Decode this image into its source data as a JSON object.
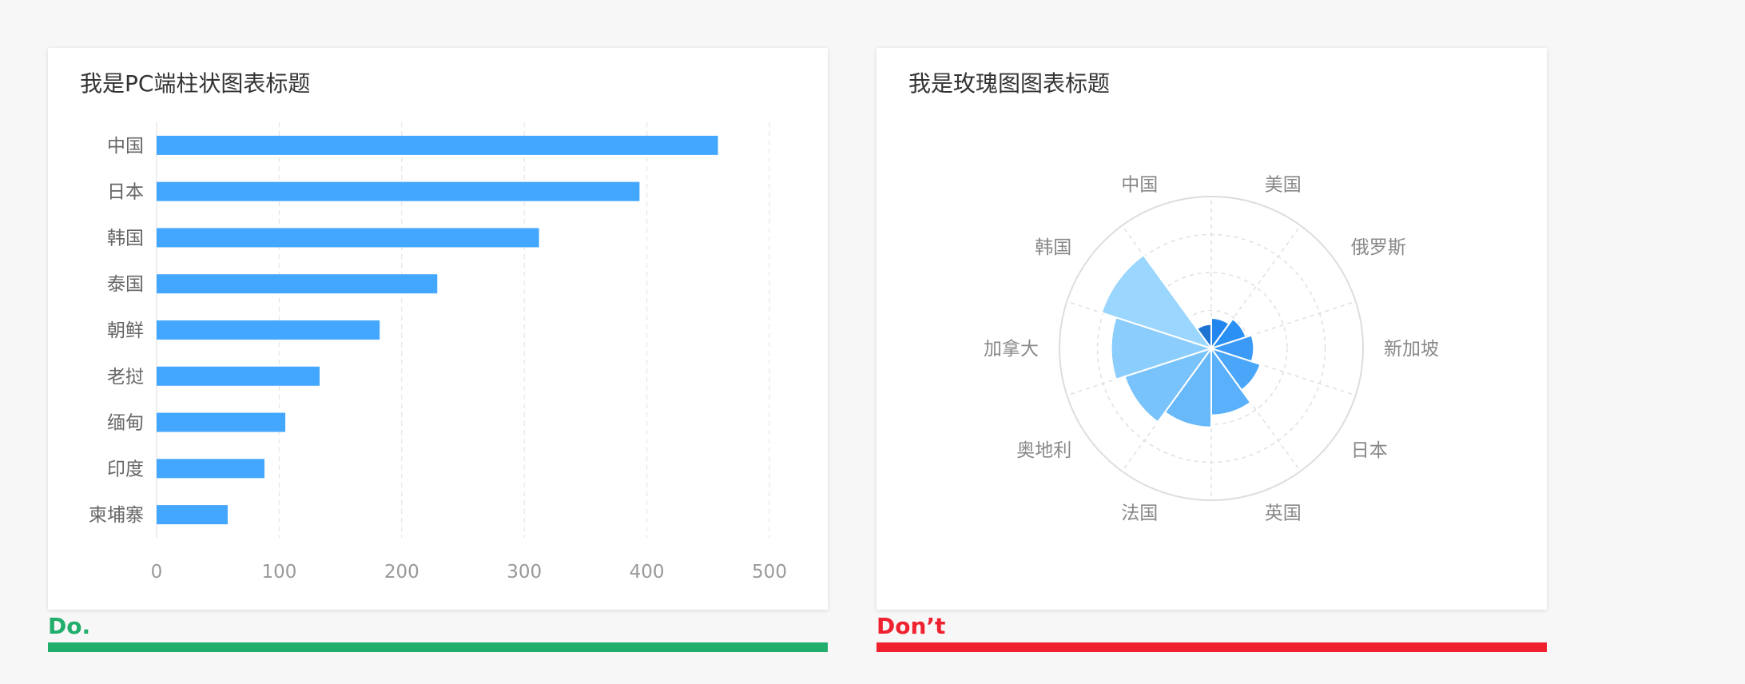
{
  "panels": {
    "do": {
      "title": "我是PC端柱状图表标题",
      "verdict": "Do.",
      "verdict_color": "#21ad6c"
    },
    "dont": {
      "title": "我是玫瑰图图表标题",
      "verdict": "Don’t",
      "verdict_color": "#f0212e"
    }
  },
  "chart_data": [
    {
      "type": "bar",
      "orientation": "horizontal",
      "title": "我是PC端柱状图表标题",
      "categories": [
        "中国",
        "日本",
        "韩国",
        "泰国",
        "朝鲜",
        "老挝",
        "缅甸",
        "印度",
        "柬埔寨"
      ],
      "values": [
        458,
        394,
        312,
        229,
        182,
        133,
        105,
        88,
        58
      ],
      "xlim": [
        0,
        500
      ],
      "xticks": [
        "0",
        "100",
        "200",
        "300",
        "400",
        "500"
      ],
      "grid": true,
      "bar_color": "#44a7ff"
    },
    {
      "type": "pie",
      "variant": "rose",
      "title": "我是玫瑰图图表标题",
      "categories": [
        "中国",
        "美国",
        "俄罗斯",
        "新加坡",
        "日本",
        "英国",
        "法国",
        "奥地利",
        "加拿大",
        "韩国"
      ],
      "values": [
        8,
        10,
        12,
        14,
        17,
        22,
        26,
        30,
        33,
        38
      ],
      "rmax": 50,
      "colors": [
        "#1c73d2",
        "#2286ee",
        "#2a90f4",
        "#3a9af6",
        "#4aa6f8",
        "#5ab0fa",
        "#68b9fa",
        "#78c3fb",
        "#8bcdfc",
        "#9ad6fd"
      ],
      "grid": true
    }
  ]
}
